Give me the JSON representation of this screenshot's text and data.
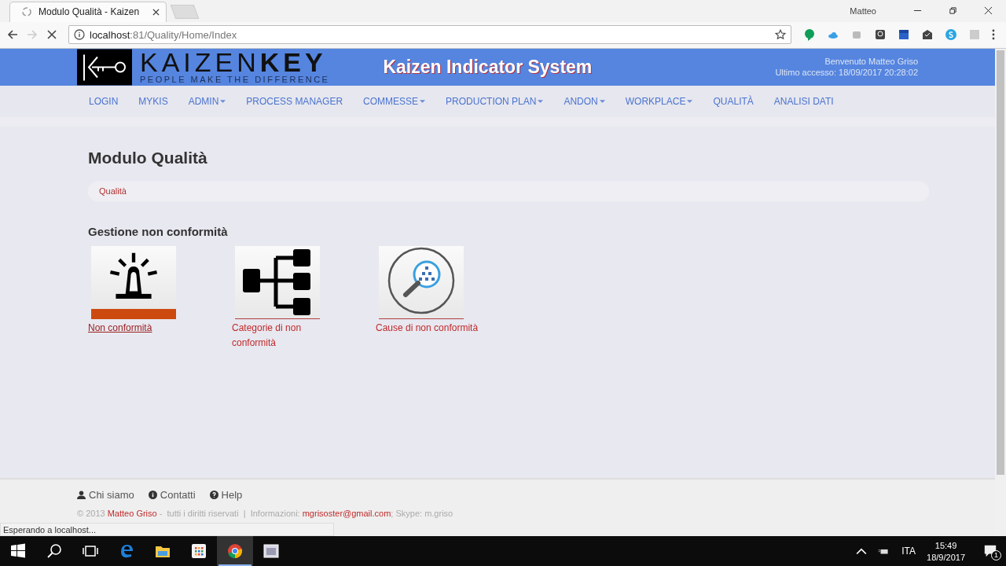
{
  "browser": {
    "tab_title": "Modulo Qualità - Kaizen",
    "profile": "Matteo",
    "address": {
      "host": "localhost",
      "path": ":81/Quality/Home/Index"
    },
    "loading": true
  },
  "header": {
    "logo_light": "KAIZEN",
    "logo_bold": "KEY",
    "tagline": "PEOPLE MAKE THE DIFFERENCE",
    "title": "Kaizen Indicator System",
    "welcome": "Benvenuto Matteo Griso",
    "last_access": "Ultimo accesso: 18/09/2017 20:28:02"
  },
  "nav": [
    {
      "label": "LOGIN",
      "dropdown": false
    },
    {
      "label": "MYKIS",
      "dropdown": false
    },
    {
      "label": "ADMIN",
      "dropdown": true
    },
    {
      "label": "PROCESS MANAGER",
      "dropdown": false
    },
    {
      "label": "COMMESSE",
      "dropdown": true
    },
    {
      "label": "PRODUCTION PLAN",
      "dropdown": true
    },
    {
      "label": "ANDON",
      "dropdown": true
    },
    {
      "label": "WORKPLACE",
      "dropdown": true
    },
    {
      "label": "QUALITÀ",
      "dropdown": false
    },
    {
      "label": "ANALISI DATI",
      "dropdown": false
    }
  ],
  "page_title": "Modulo Qualità",
  "breadcrumb": "Qualità",
  "section_title": "Gestione non conformità",
  "tiles": [
    {
      "kind": "alarm",
      "label": "Non conformità",
      "hovered": true
    },
    {
      "kind": "hierarchy",
      "label": "Categorie di non conformità",
      "hovered": false
    },
    {
      "kind": "search",
      "label": "Cause di non conformità",
      "hovered": false
    }
  ],
  "footer": {
    "links": [
      {
        "kind": "user",
        "label": "Chi siamo"
      },
      {
        "kind": "info",
        "label": "Contatti"
      },
      {
        "kind": "help",
        "label": "Help"
      }
    ],
    "copyright": "© 2013",
    "author": "Matteo Griso",
    "rights": "-  tutti i diritti riservati  |  Informazioni:",
    "email": "mgrisoster@gmail.com",
    "skype": "; Skype: m.griso"
  },
  "status": "Esperando a localhost...",
  "taskbar": {
    "apps": [
      {
        "kind": "start",
        "active": false
      },
      {
        "kind": "search",
        "active": false
      },
      {
        "kind": "taskview",
        "active": false
      },
      {
        "kind": "edge",
        "active": false
      },
      {
        "kind": "explorer",
        "active": false
      },
      {
        "kind": "store",
        "active": false
      },
      {
        "kind": "chrome",
        "active": true
      },
      {
        "kind": "window",
        "active": false
      }
    ],
    "language": "ITA",
    "time": "15:49",
    "date": "18/9/2017",
    "notifications": "1"
  }
}
